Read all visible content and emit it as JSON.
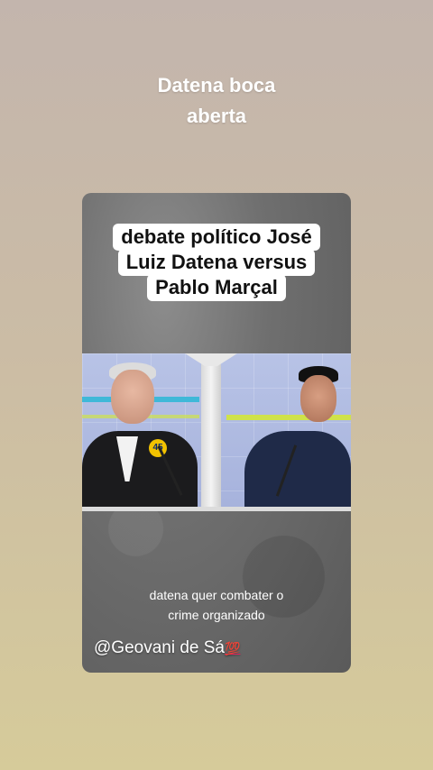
{
  "story": {
    "title_line1": "Datena boca",
    "title_line2": "aberta"
  },
  "card": {
    "headline_line1": "debate político José",
    "headline_line2": "Luiz Datena versus",
    "headline_line3": "Pablo Marçal",
    "badge_number": "45",
    "caption_line1": "datena quer combater o",
    "caption_line2": "crime organizado",
    "watermark": "@Geovani de Sá",
    "watermark_emoji": "💯"
  },
  "colors": {
    "background_top": "#c3b5ad",
    "background_bottom": "#d6cb9a",
    "headline_bg": "#ffffff",
    "emoji_red": "#e0245e"
  }
}
